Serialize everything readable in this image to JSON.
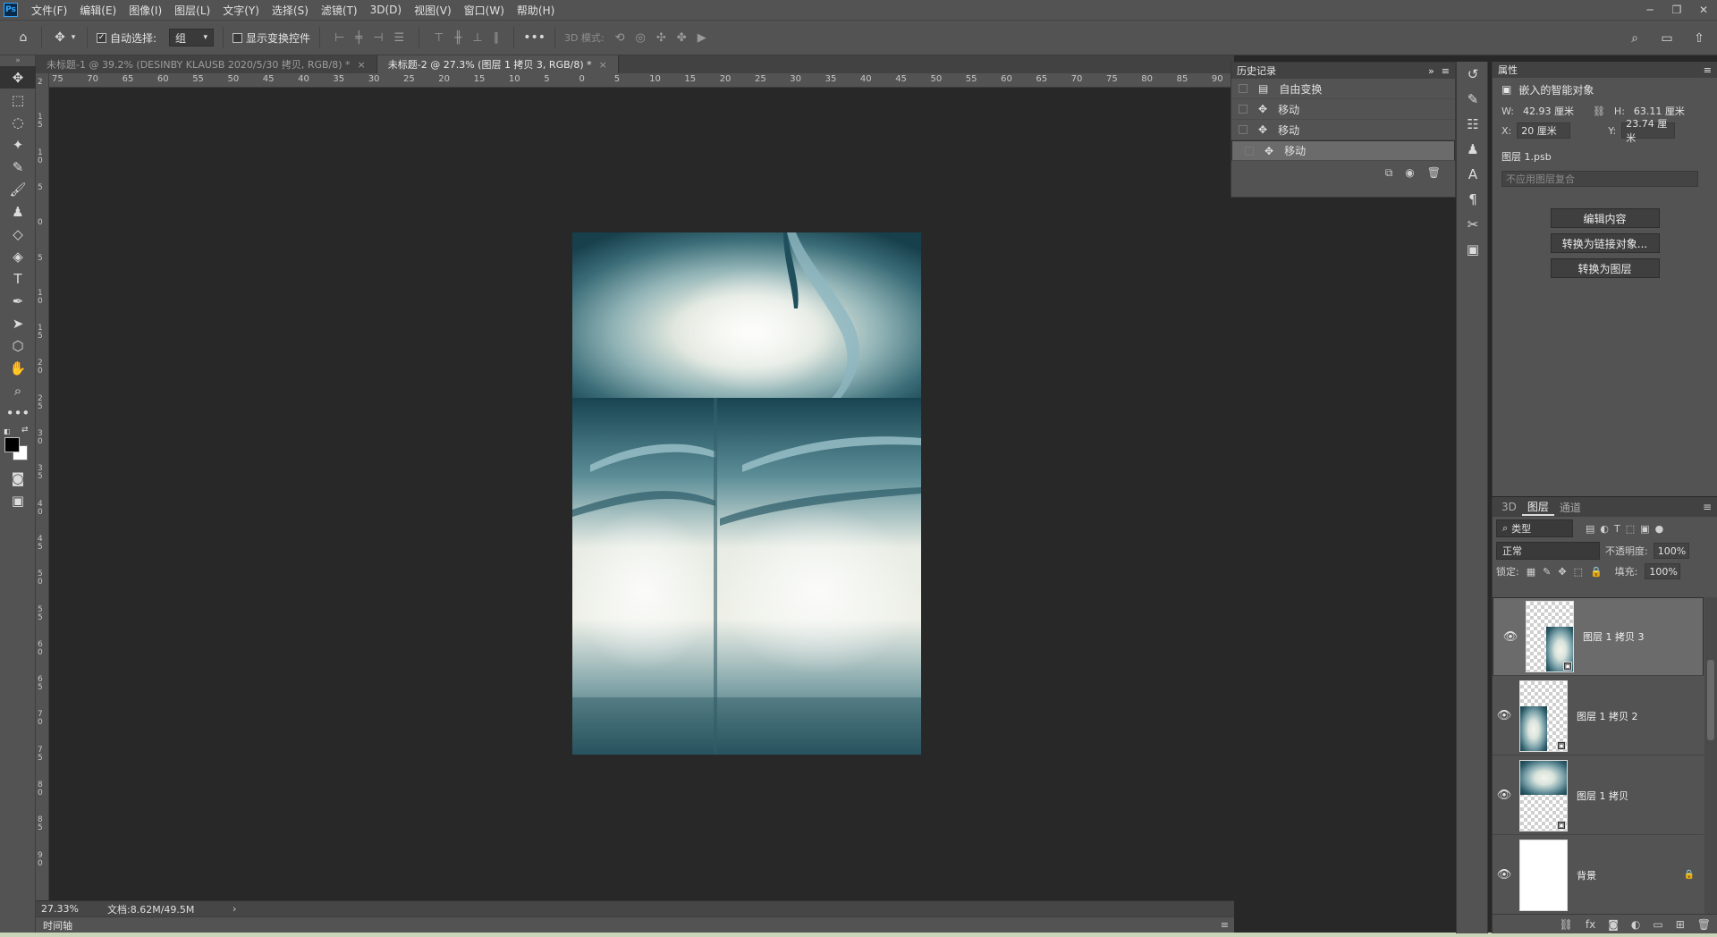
{
  "app": {
    "logo": "Ps"
  },
  "menu": [
    "文件(F)",
    "编辑(E)",
    "图像(I)",
    "图层(L)",
    "文字(Y)",
    "选择(S)",
    "滤镜(T)",
    "3D(D)",
    "视图(V)",
    "窗口(W)",
    "帮助(H)"
  ],
  "options": {
    "auto_select_label": "自动选择:",
    "auto_select_value": "组",
    "show_transform_label": "显示变换控件",
    "mode_3d_label": "3D 模式:"
  },
  "tabs": [
    {
      "label": "未标题-1 @ 39.2% (DESINBY KLAUSB   2020/5/30 拷贝, RGB/8) *"
    },
    {
      "label": "未标题-2 @ 27.3% (图层 1 拷贝 3, RGB/8) *"
    }
  ],
  "ruler": {
    "h": [
      "75",
      "70",
      "65",
      "60",
      "55",
      "50",
      "45",
      "40",
      "35",
      "30",
      "25",
      "20",
      "15",
      "10",
      "5",
      "0",
      "5",
      "10",
      "15",
      "20",
      "25",
      "30",
      "35",
      "40",
      "45",
      "50",
      "55",
      "60",
      "65",
      "70",
      "75",
      "80",
      "85",
      "90"
    ],
    "v": [
      "2",
      "1 5",
      "1 0",
      "5",
      "0",
      "5",
      "1 0",
      "1 5",
      "2 0",
      "2 5",
      "3 0",
      "3 5",
      "4 0",
      "4 5",
      "5 0",
      "5 5",
      "6 0",
      "6 5",
      "7 0",
      "7 5",
      "8 0",
      "8 5",
      "9 0"
    ]
  },
  "status": {
    "zoom": "27.33%",
    "doc": "文档:8.62M/49.5M"
  },
  "timeline": {
    "label": "时间轴"
  },
  "history": {
    "title": "历史记录",
    "items": [
      {
        "label": "自由变换",
        "icon": "document-icon"
      },
      {
        "label": "移动",
        "icon": "move-icon"
      },
      {
        "label": "移动",
        "icon": "move-icon"
      },
      {
        "label": "移动",
        "icon": "move-icon"
      }
    ]
  },
  "properties": {
    "title": "属性",
    "kind": "嵌入的智能对象",
    "w_label": "W:",
    "w_value": "42.93 厘米",
    "h_label": "H:",
    "h_value": "63.11 厘米",
    "x_label": "X:",
    "x_value": "20 厘米",
    "y_label": "Y:",
    "y_value": "23.74 厘米",
    "file": "图层 1.psb",
    "comp_placeholder": "不应用图层复合",
    "buttons": [
      "编辑内容",
      "转换为链接对象...",
      "转换为图层"
    ]
  },
  "layers": {
    "tabs": [
      "3D",
      "图层",
      "通道"
    ],
    "filter": "类型",
    "blend": "正常",
    "opacity_label": "不透明度:",
    "opacity": "100%",
    "lock_label": "锁定:",
    "fill_label": "填充:",
    "fill": "100%",
    "items": [
      {
        "name": "图层 1 拷贝 3",
        "selected": true
      },
      {
        "name": "图层 1 拷贝 2",
        "selected": false
      },
      {
        "name": "图层 1 拷贝",
        "selected": false
      },
      {
        "name": "背景",
        "selected": false
      }
    ]
  },
  "colors": {
    "accent": "#31a8ff",
    "ui_bg": "#535353",
    "canvas_bg": "#282828"
  }
}
